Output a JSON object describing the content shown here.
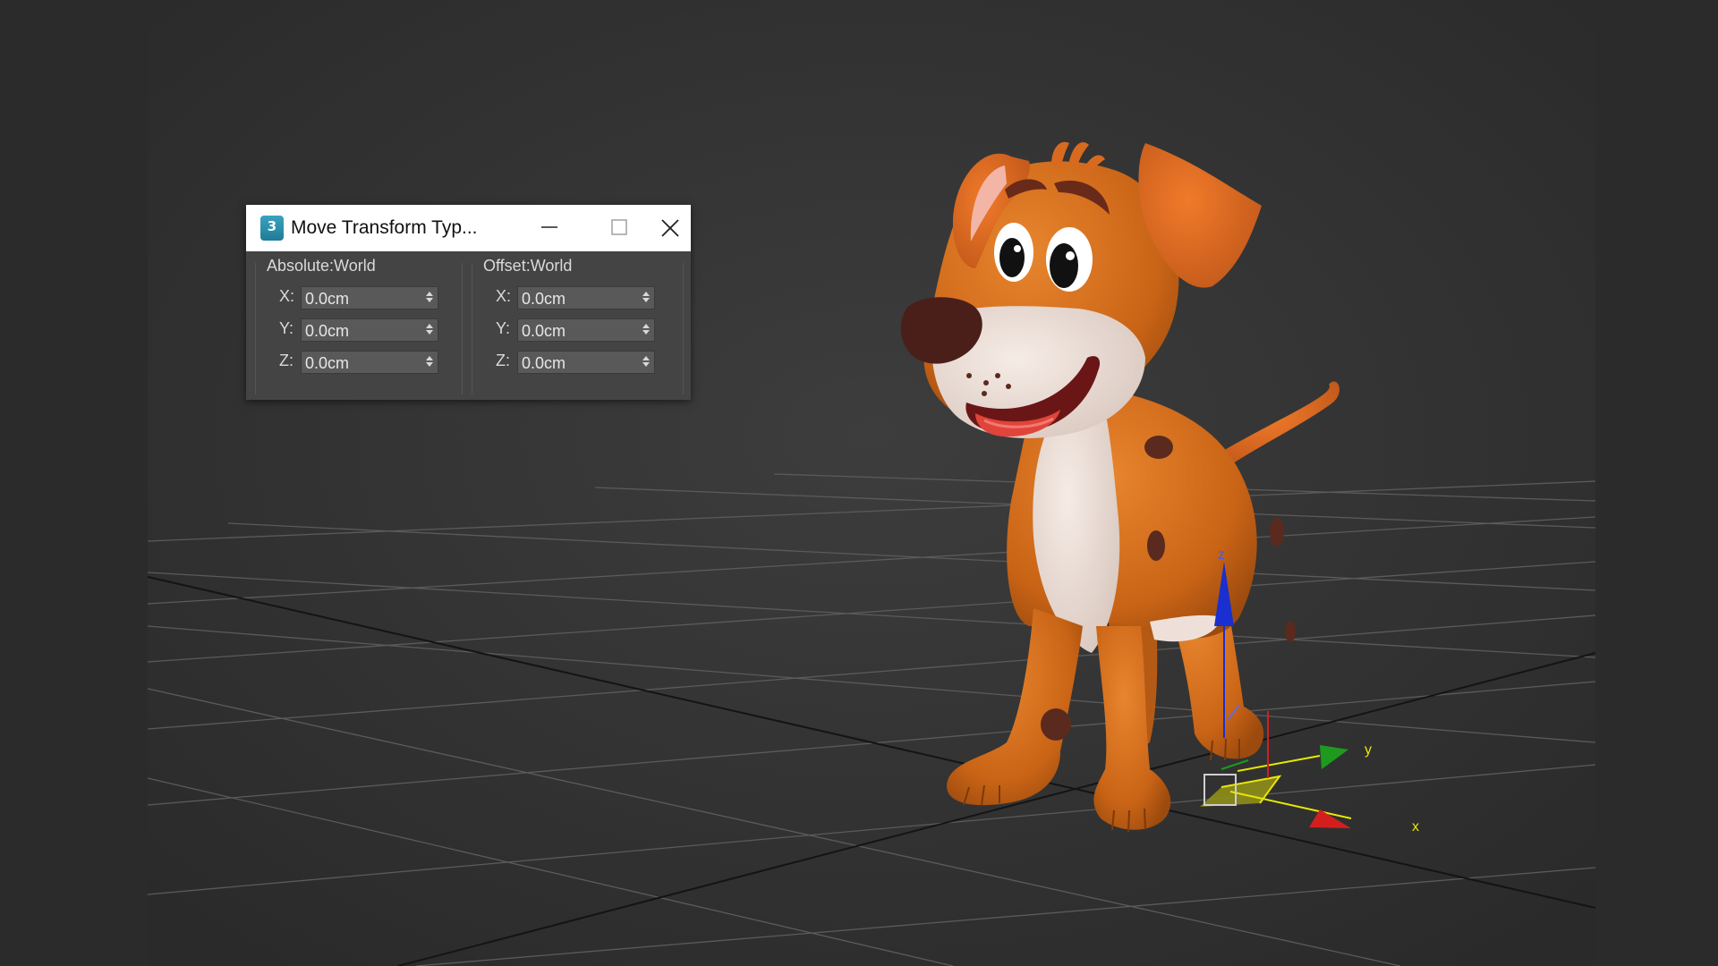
{
  "dialog": {
    "title": "Move Transform Typ...",
    "icon": "3ds-max-app-icon",
    "absolute": {
      "title": "Absolute:World",
      "fields": [
        {
          "label": "X:",
          "value": "0.0cm"
        },
        {
          "label": "Y:",
          "value": "0.0cm"
        },
        {
          "label": "Z:",
          "value": "0.0cm"
        }
      ]
    },
    "offset": {
      "title": "Offset:World",
      "fields": [
        {
          "label": "X:",
          "value": "0.0cm"
        },
        {
          "label": "Y:",
          "value": "0.0cm"
        },
        {
          "label": "Z:",
          "value": "0.0cm"
        }
      ]
    }
  },
  "gizmo": {
    "x_label": "x",
    "y_label": "y",
    "z_label": "z",
    "colors": {
      "x": "#d41e1e",
      "y": "#1e9a1e",
      "z": "#1a2fcf",
      "plane": "#e8e800"
    }
  },
  "viewport": {
    "background": "#2b2b2b",
    "grid_color": "#5a5a5a",
    "model": "cartoon-dog"
  }
}
